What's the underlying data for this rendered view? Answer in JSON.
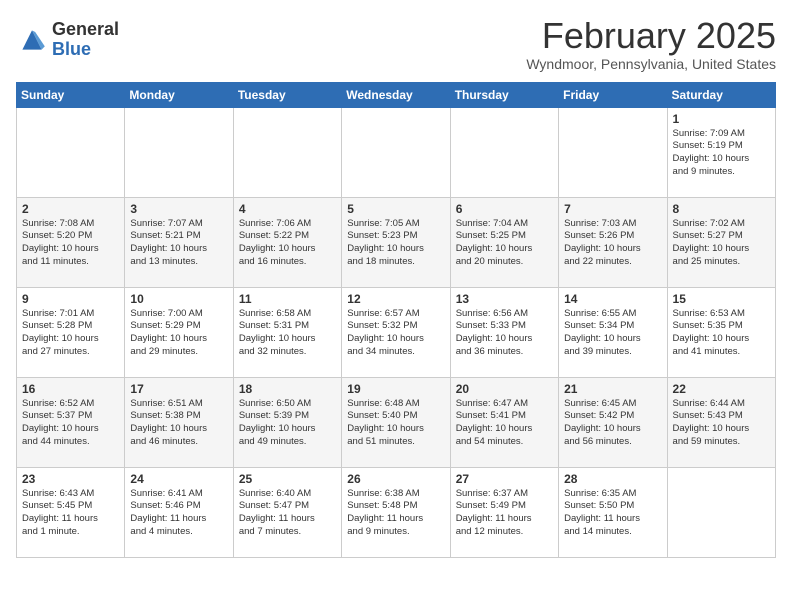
{
  "header": {
    "logo_general": "General",
    "logo_blue": "Blue",
    "month_title": "February 2025",
    "location": "Wyndmoor, Pennsylvania, United States"
  },
  "weekdays": [
    "Sunday",
    "Monday",
    "Tuesday",
    "Wednesday",
    "Thursday",
    "Friday",
    "Saturday"
  ],
  "weeks": [
    [
      {
        "day": "",
        "info": ""
      },
      {
        "day": "",
        "info": ""
      },
      {
        "day": "",
        "info": ""
      },
      {
        "day": "",
        "info": ""
      },
      {
        "day": "",
        "info": ""
      },
      {
        "day": "",
        "info": ""
      },
      {
        "day": "1",
        "info": "Sunrise: 7:09 AM\nSunset: 5:19 PM\nDaylight: 10 hours\nand 9 minutes."
      }
    ],
    [
      {
        "day": "2",
        "info": "Sunrise: 7:08 AM\nSunset: 5:20 PM\nDaylight: 10 hours\nand 11 minutes."
      },
      {
        "day": "3",
        "info": "Sunrise: 7:07 AM\nSunset: 5:21 PM\nDaylight: 10 hours\nand 13 minutes."
      },
      {
        "day": "4",
        "info": "Sunrise: 7:06 AM\nSunset: 5:22 PM\nDaylight: 10 hours\nand 16 minutes."
      },
      {
        "day": "5",
        "info": "Sunrise: 7:05 AM\nSunset: 5:23 PM\nDaylight: 10 hours\nand 18 minutes."
      },
      {
        "day": "6",
        "info": "Sunrise: 7:04 AM\nSunset: 5:25 PM\nDaylight: 10 hours\nand 20 minutes."
      },
      {
        "day": "7",
        "info": "Sunrise: 7:03 AM\nSunset: 5:26 PM\nDaylight: 10 hours\nand 22 minutes."
      },
      {
        "day": "8",
        "info": "Sunrise: 7:02 AM\nSunset: 5:27 PM\nDaylight: 10 hours\nand 25 minutes."
      }
    ],
    [
      {
        "day": "9",
        "info": "Sunrise: 7:01 AM\nSunset: 5:28 PM\nDaylight: 10 hours\nand 27 minutes."
      },
      {
        "day": "10",
        "info": "Sunrise: 7:00 AM\nSunset: 5:29 PM\nDaylight: 10 hours\nand 29 minutes."
      },
      {
        "day": "11",
        "info": "Sunrise: 6:58 AM\nSunset: 5:31 PM\nDaylight: 10 hours\nand 32 minutes."
      },
      {
        "day": "12",
        "info": "Sunrise: 6:57 AM\nSunset: 5:32 PM\nDaylight: 10 hours\nand 34 minutes."
      },
      {
        "day": "13",
        "info": "Sunrise: 6:56 AM\nSunset: 5:33 PM\nDaylight: 10 hours\nand 36 minutes."
      },
      {
        "day": "14",
        "info": "Sunrise: 6:55 AM\nSunset: 5:34 PM\nDaylight: 10 hours\nand 39 minutes."
      },
      {
        "day": "15",
        "info": "Sunrise: 6:53 AM\nSunset: 5:35 PM\nDaylight: 10 hours\nand 41 minutes."
      }
    ],
    [
      {
        "day": "16",
        "info": "Sunrise: 6:52 AM\nSunset: 5:37 PM\nDaylight: 10 hours\nand 44 minutes."
      },
      {
        "day": "17",
        "info": "Sunrise: 6:51 AM\nSunset: 5:38 PM\nDaylight: 10 hours\nand 46 minutes."
      },
      {
        "day": "18",
        "info": "Sunrise: 6:50 AM\nSunset: 5:39 PM\nDaylight: 10 hours\nand 49 minutes."
      },
      {
        "day": "19",
        "info": "Sunrise: 6:48 AM\nSunset: 5:40 PM\nDaylight: 10 hours\nand 51 minutes."
      },
      {
        "day": "20",
        "info": "Sunrise: 6:47 AM\nSunset: 5:41 PM\nDaylight: 10 hours\nand 54 minutes."
      },
      {
        "day": "21",
        "info": "Sunrise: 6:45 AM\nSunset: 5:42 PM\nDaylight: 10 hours\nand 56 minutes."
      },
      {
        "day": "22",
        "info": "Sunrise: 6:44 AM\nSunset: 5:43 PM\nDaylight: 10 hours\nand 59 minutes."
      }
    ],
    [
      {
        "day": "23",
        "info": "Sunrise: 6:43 AM\nSunset: 5:45 PM\nDaylight: 11 hours\nand 1 minute."
      },
      {
        "day": "24",
        "info": "Sunrise: 6:41 AM\nSunset: 5:46 PM\nDaylight: 11 hours\nand 4 minutes."
      },
      {
        "day": "25",
        "info": "Sunrise: 6:40 AM\nSunset: 5:47 PM\nDaylight: 11 hours\nand 7 minutes."
      },
      {
        "day": "26",
        "info": "Sunrise: 6:38 AM\nSunset: 5:48 PM\nDaylight: 11 hours\nand 9 minutes."
      },
      {
        "day": "27",
        "info": "Sunrise: 6:37 AM\nSunset: 5:49 PM\nDaylight: 11 hours\nand 12 minutes."
      },
      {
        "day": "28",
        "info": "Sunrise: 6:35 AM\nSunset: 5:50 PM\nDaylight: 11 hours\nand 14 minutes."
      },
      {
        "day": "",
        "info": ""
      }
    ]
  ]
}
